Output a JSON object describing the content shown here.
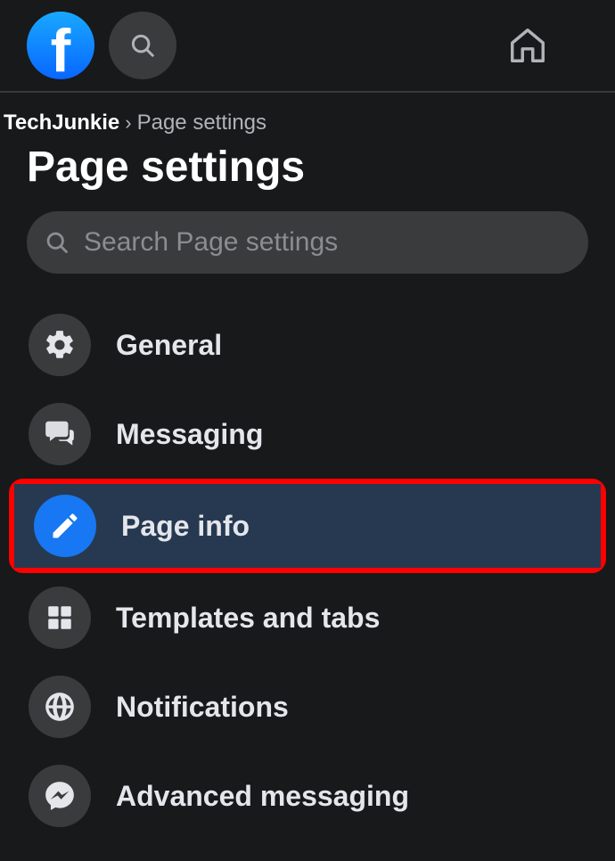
{
  "breadcrumb": {
    "root": "TechJunkie",
    "current": "Page settings"
  },
  "page_title": "Page settings",
  "search": {
    "placeholder": "Search Page settings",
    "value": ""
  },
  "menu": {
    "items": [
      {
        "label": "General",
        "icon": "gear-icon",
        "active": false,
        "highlight": false
      },
      {
        "label": "Messaging",
        "icon": "messaging-icon",
        "active": false,
        "highlight": false
      },
      {
        "label": "Page info",
        "icon": "pencil-icon",
        "active": true,
        "highlight": true
      },
      {
        "label": "Templates and tabs",
        "icon": "grid-icon",
        "active": false,
        "highlight": false
      },
      {
        "label": "Notifications",
        "icon": "globe-icon",
        "active": false,
        "highlight": false
      },
      {
        "label": "Advanced messaging",
        "icon": "messenger-icon",
        "active": false,
        "highlight": false
      }
    ]
  }
}
